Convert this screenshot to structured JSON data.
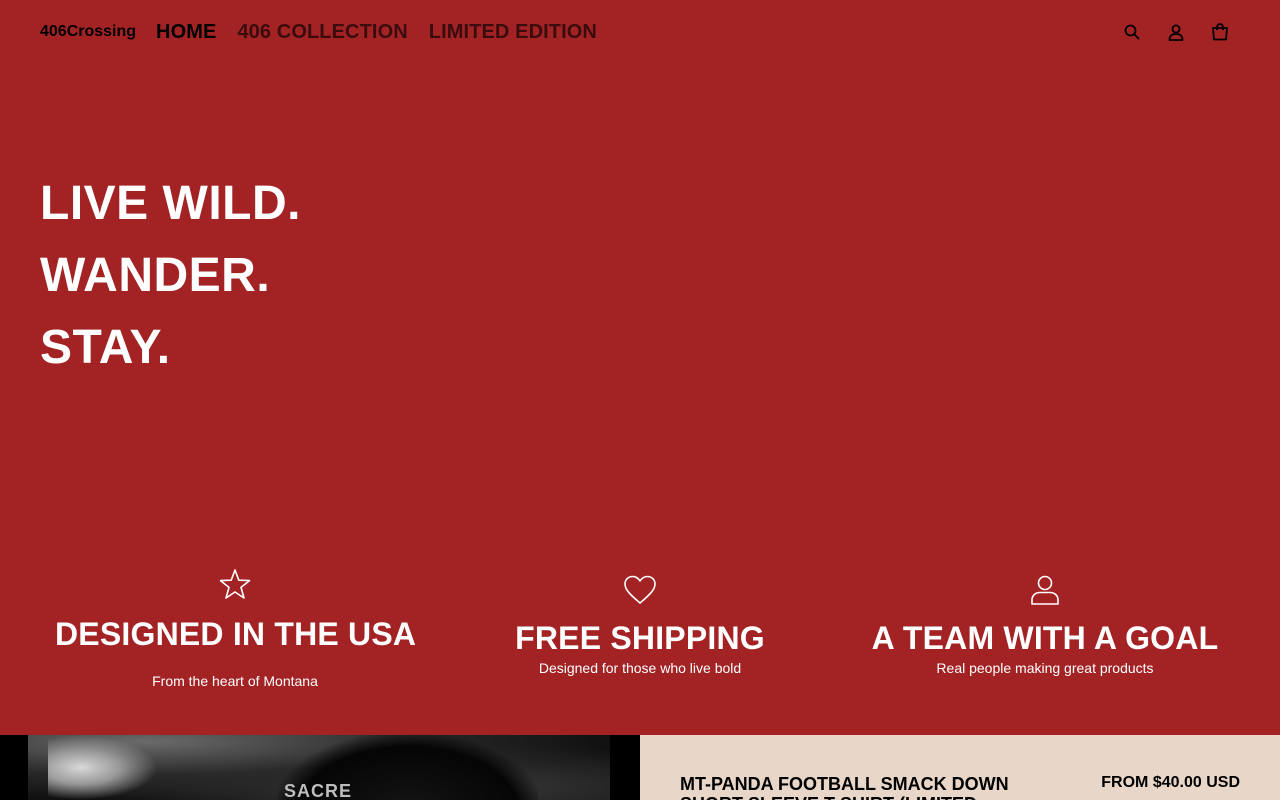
{
  "header": {
    "brand": "406Crossing",
    "nav": [
      {
        "label": "HOME"
      },
      {
        "label": "406 COLLECTION"
      },
      {
        "label": "LIMITED EDITION"
      }
    ],
    "icons": [
      "search-icon",
      "account-icon",
      "cart-icon"
    ]
  },
  "hero": {
    "lines": [
      "LIVE WILD.",
      "WANDER.",
      "STAY."
    ]
  },
  "features": [
    {
      "icon": "star-icon",
      "title": "DESIGNED IN THE USA",
      "subtitle": "From the heart of Montana"
    },
    {
      "icon": "heart-icon",
      "title": "FREE SHIPPING",
      "subtitle": "Designed for those who live bold"
    },
    {
      "icon": "person-icon",
      "title": "A TEAM WITH A GOAL",
      "subtitle": "Real people making great products"
    }
  ],
  "featured_product": {
    "image_text": "SACRE",
    "title": "MT-PANDA FOOTBALL SMACK DOWN SHORT SLEEVE T-SHIRT (LIMITED",
    "price": "FROM $40.00 USD"
  },
  "colors": {
    "background": "#a32325",
    "text_light": "#ffffff",
    "text_dark": "#000000",
    "product_panel": "#e8d6c8"
  }
}
